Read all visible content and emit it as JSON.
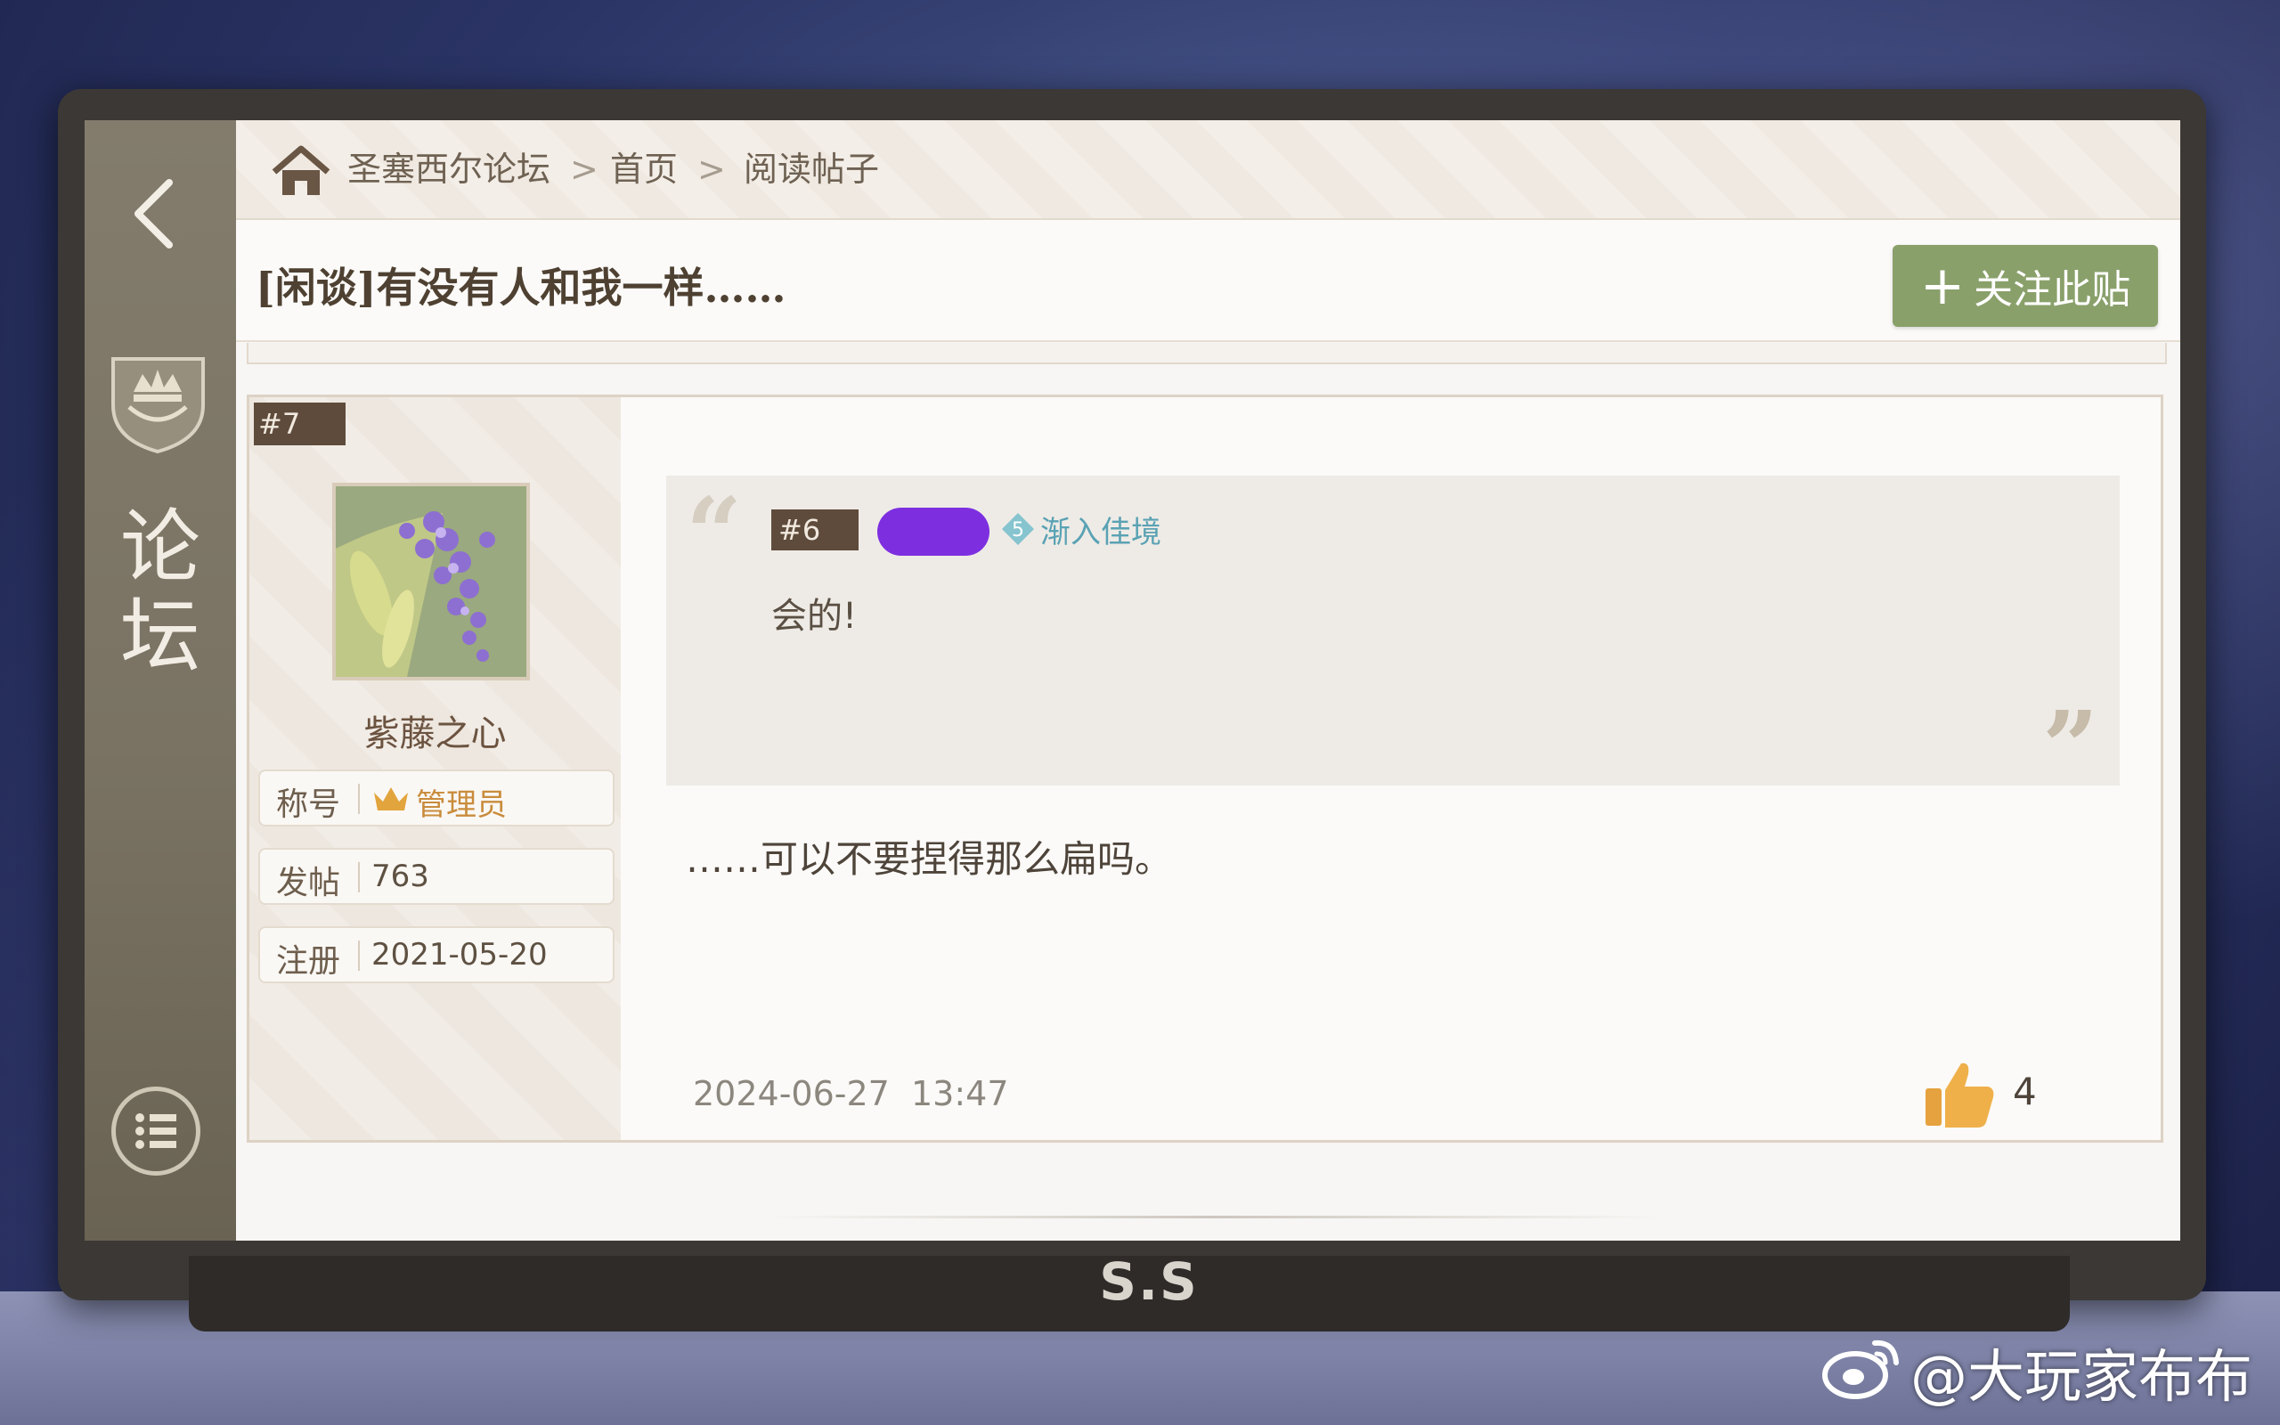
{
  "breadcrumb": {
    "items": [
      "圣塞西尔论坛",
      "首页",
      "阅读帖子"
    ],
    "separator": ">"
  },
  "sidebar": {
    "title_chars": [
      "论",
      "坛"
    ]
  },
  "post": {
    "title": "[闲谈]有没有人和我一样……",
    "follow_button": "关注此贴",
    "follow_plus": "+",
    "floor": "#7",
    "reply_text": "……可以不要捏得那么扁吗。",
    "time": "2024-06-27  13:47",
    "likes": "4"
  },
  "author": {
    "name": "紫藤之心",
    "rows": [
      {
        "label": "称号",
        "value": "管理员"
      },
      {
        "label": "发帖",
        "value": "763"
      },
      {
        "label": "注册",
        "value": "2021-05-20"
      }
    ]
  },
  "quote": {
    "floor": "#6",
    "level_number": "5",
    "level_name": "渐入佳境",
    "text": "会的!"
  },
  "device": {
    "brand": "S.S"
  },
  "watermark": {
    "text": "@大玩家布布"
  },
  "colors": {
    "accent_green": "#8aa06b",
    "sidebar_brown": "#7d7666",
    "tag_brown": "#5e4b3b",
    "admin_gold": "#c98c3c",
    "level_teal": "#5aa2b4",
    "redaction_purple": "#7d2fe0"
  },
  "icons": [
    "home-icon",
    "back-icon",
    "crest-icon",
    "menu-icon",
    "crown-icon",
    "thumbs-up-icon",
    "level-badge-icon",
    "weibo-icon"
  ]
}
